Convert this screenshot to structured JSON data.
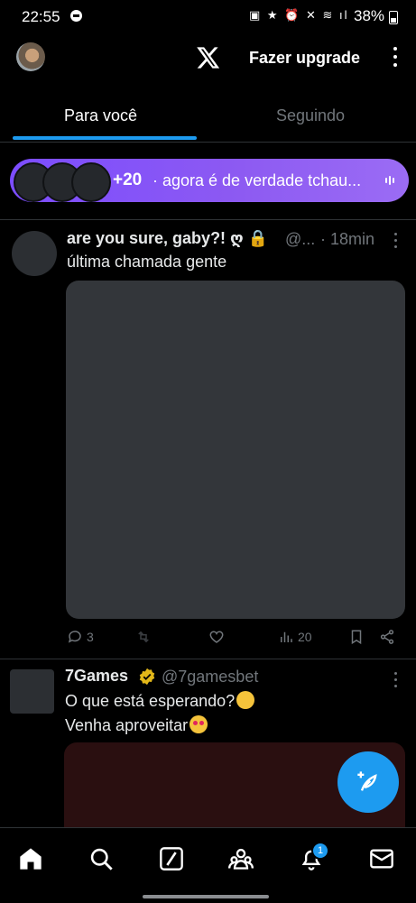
{
  "status_bar": {
    "time": "22:55",
    "battery": "38%"
  },
  "header": {
    "upgrade_label": "Fazer upgrade"
  },
  "tabs": [
    {
      "label": "Para você",
      "active": true
    },
    {
      "label": "Seguindo",
      "active": false
    }
  ],
  "space": {
    "listener_count": "+20",
    "title": "· agora é de verdade tchau..."
  },
  "tweets": [
    {
      "name": "are you sure, gaby?! ღ 🔒",
      "handle": "@...",
      "time": "· 18min",
      "text": "última chamada gente",
      "replies": "3",
      "views": "20"
    },
    {
      "name": "7Games",
      "handle": "@7gamesbet",
      "verified": "gold",
      "line1": "O que está esperando?",
      "line2": "Venha aproveitar"
    }
  ],
  "nav": {
    "notifications_badge": "1"
  },
  "colors": {
    "accent": "#1d9bf0",
    "space_gradient": "#8c59f2",
    "background": "#000000"
  }
}
